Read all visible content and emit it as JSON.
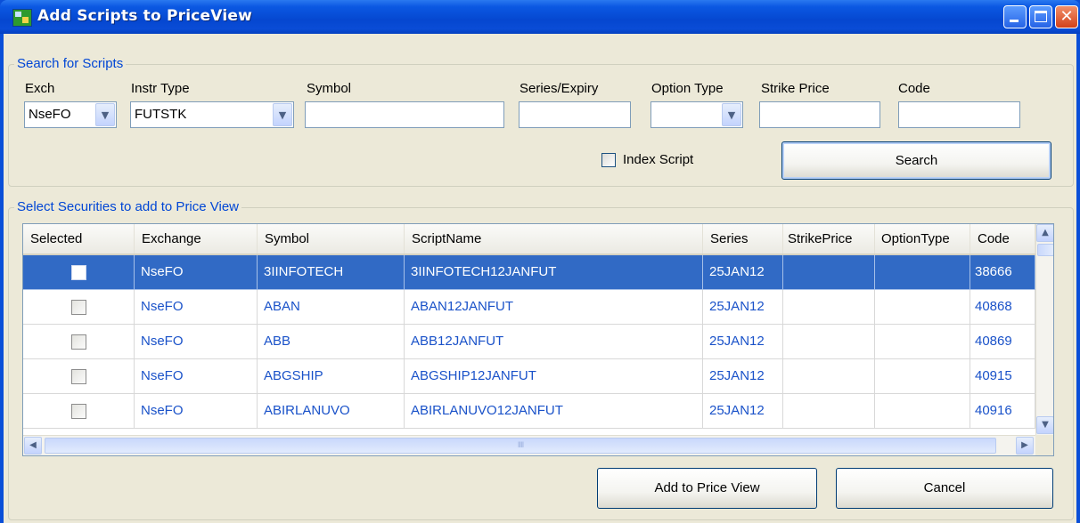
{
  "window": {
    "title": "Add Scripts to PriceView",
    "close_glyph": "✕"
  },
  "search": {
    "legend": "Search for Scripts",
    "exch_label": "Exch",
    "exch_value": "NseFO",
    "instr_label": "Instr Type",
    "instr_value": "FUTSTK",
    "symbol_label": "Symbol",
    "symbol_value": "",
    "series_label": "Series/Expiry",
    "series_value": "",
    "option_label": "Option Type",
    "option_value": "",
    "strike_label": "Strike Price",
    "strike_value": "",
    "code_label": "Code",
    "code_value": "",
    "index_label": "Index Script",
    "index_checked": false,
    "search_button": "Search"
  },
  "securities": {
    "legend": "Select Securities to add to Price View",
    "columns": [
      "Selected",
      "Exchange",
      "Symbol",
      "ScriptName",
      "Series",
      "StrikePrice",
      "OptionType",
      "Code"
    ],
    "rows": [
      {
        "selected": false,
        "exchange": "NseFO",
        "symbol": "3IINFOTECH",
        "script": "3IINFOTECH12JANFUT",
        "series": "25JAN12",
        "strike": "",
        "option": "",
        "code": "38666",
        "highlighted": true
      },
      {
        "selected": false,
        "exchange": "NseFO",
        "symbol": "ABAN",
        "script": "ABAN12JANFUT",
        "series": "25JAN12",
        "strike": "",
        "option": "",
        "code": "40868",
        "highlighted": false
      },
      {
        "selected": false,
        "exchange": "NseFO",
        "symbol": "ABB",
        "script": "ABB12JANFUT",
        "series": "25JAN12",
        "strike": "",
        "option": "",
        "code": "40869",
        "highlighted": false
      },
      {
        "selected": false,
        "exchange": "NseFO",
        "symbol": "ABGSHIP",
        "script": "ABGSHIP12JANFUT",
        "series": "25JAN12",
        "strike": "",
        "option": "",
        "code": "40915",
        "highlighted": false
      },
      {
        "selected": false,
        "exchange": "NseFO",
        "symbol": "ABIRLANUVO",
        "script": "ABIRLANUVO12JANFUT",
        "series": "25JAN12",
        "strike": "",
        "option": "",
        "code": "40916",
        "highlighted": false
      }
    ],
    "scroll_grip": "IIII"
  },
  "footer": {
    "add_button": "Add to Price View",
    "cancel_button": "Cancel"
  },
  "colors": {
    "title_bar": "#0a4fd8",
    "selection": "#316ac5",
    "legend_text": "#0046d5",
    "cell_text": "#1a52c9",
    "face": "#ece9d8"
  }
}
